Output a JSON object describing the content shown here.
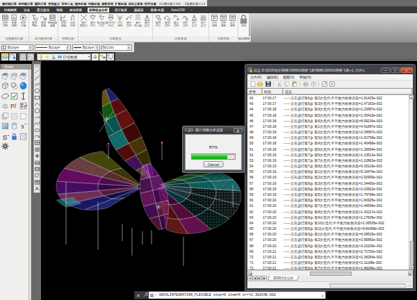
{
  "menubar": {
    "items": [
      "钢结构计算",
      "砼结构计算",
      "辅助计算",
      "查询显示",
      "常用工具",
      "通用处理",
      "结构处理",
      "参数查询",
      "扩展处理",
      "自定义菜单",
      "软件设置"
    ],
    "scale1": "【出图比例 1:25】",
    "scale2": "【绘图比例 1:1 】"
  },
  "tabbar": {
    "items": [
      "结构建模",
      "实体",
      "显示查询",
      "编辑",
      "施加荷载",
      "荷载组合分析",
      "设计验算",
      "膜裁剪",
      "楼梯-支座",
      "AutoCAD"
    ],
    "active": "荷载组合分析"
  },
  "ribbon": {
    "groups": [
      {
        "label": "自振特性计算",
        "buttons": [
          {
            "label1": "结构",
            "label2": "类型"
          },
          {
            "label1": "检查",
            "label2": "模型"
          },
          {
            "label1": "结构",
            "label2": "计算"
          }
        ]
      },
      {
        "label": "动力特性结果",
        "buttons": [
          {
            "label1": "查询",
            "label2": "周期"
          },
          {
            "label1": "查询",
            "label2": "振型"
          },
          {
            "label1": "周期振型",
            "label2": "参数"
          }
        ]
      },
      {
        "label": "时程分析",
        "buttons": [
          {
            "label1": "时程",
            "label2": "曲线"
          },
          {
            "label1": "动态",
            "label2": "位移"
          }
        ]
      },
      {
        "label": "结果显示",
        "buttons": [
          {
            "label1": "显示",
            "label2": "面应力"
          },
          {
            "label1": "显示",
            "label2": "内力"
          },
          {
            "label1": "最大组合",
            "label2": "内力"
          },
          {
            "label1": "显示内力",
            "label2": "标注"
          },
          {
            "label1": "内力",
            "label2": "包络"
          },
          {
            "label1": "显示",
            "label2": "位移"
          },
          {
            "label1": "显示",
            "label2": "等高线"
          },
          {
            "label1": "显示",
            "label2": "反力"
          }
        ]
      },
      {
        "label": "结果查询",
        "buttons": [
          {
            "label1": "查询",
            "label2": "内力"
          },
          {
            "label1": "查询",
            "label2": "位移"
          },
          {
            "label1": "最大",
            "label2": "位移"
          },
          {
            "label1": "相对",
            "label2": "位移"
          },
          {
            "label1": "单个",
            "label2": "反力"
          },
          {
            "label1": "多个",
            "label2": "反力"
          }
        ]
      },
      {
        "label": "结果表格",
        "buttons": [
          {
            "label1": "内力",
            "label2": "表格",
            "glyph": "F"
          },
          {
            "label1": "位移",
            "label2": "表格",
            "glyph": "D"
          },
          {
            "label1": "反力",
            "label2": "表格",
            "glyph": "R"
          }
        ]
      },
      {
        "label": "锁定解锁",
        "buttons": [
          {
            "label1": "锁定",
            "label2": ""
          }
        ]
      }
    ]
  },
  "propsbar": {
    "color": "ByLayer",
    "linetype": "ByLayer",
    "lineweight": "ByLayer",
    "plotstyle": "ByColor"
  },
  "layersbar": {
    "layer": "结构层"
  },
  "palette": {
    "title": "Tools"
  },
  "dialog": {
    "title": "工况1--累计荷载分析进度",
    "percent": "87%",
    "progress": 82,
    "cancel_label": "Cancel",
    "close_label": "x",
    "accent": "#2fce27"
  },
  "logwin": {
    "title": "日志 D:\\2019项目\\蝴蝶\\190601蝴蝶飞舞\\蝴蝶\\190601蝴蝶飞舞+1_V14.1",
    "menu": [
      "文件(F)",
      "编辑(E)",
      "视图(V)",
      "帮助(H)"
    ],
    "columns": [
      "序号",
      "时间",
      "信息"
    ],
    "rows": [
      {
        "seq": "42",
        "time": "17:00:17",
        "msg": "------正在进行第6步 第2次迭代,不平衡力收敛误差=1.81425e-002"
      },
      {
        "seq": "43",
        "time": "17:00:17",
        "msg": "------正在进行第6步 第3次迭代,不平衡力收敛误差=1.47163e-002"
      },
      {
        "seq": "44",
        "time": "17:00:18",
        "msg": "------正在进行第6步 第4次迭代,不平衡力收敛误差=1.23957e-002"
      },
      {
        "seq": "45",
        "time": "17:00:18",
        "msg": "------正在进行第6步 第5次迭代,不平衡力收敛误差=1.05419e-002"
      },
      {
        "seq": "46",
        "time": "17:00:18",
        "msg": "------正在进行第6步 第6次迭代,不平衡力收敛误差=8.99234e-003"
      },
      {
        "seq": "47",
        "time": "17:00:18",
        "msg": "------正在进行第7步 第1次迭代,不平衡力收敛误差=4.91897e-002"
      },
      {
        "seq": "48",
        "time": "17:00:18",
        "msg": "------正在进行第7步 第2次迭代,不平衡力收敛误差=2.08597e-002"
      },
      {
        "seq": "49",
        "time": "17:00:18",
        "msg": "------正在进行第7步 第3次迭代,不平衡力收敛误差=1.62758e-002"
      },
      {
        "seq": "50",
        "time": "17:00:18",
        "msg": "------正在进行第7步 第4次迭代,不平衡力收敛误差=1.40498e-002"
      },
      {
        "seq": "51",
        "time": "17:00:18",
        "msg": "------正在进行第7步 第5次迭代,不平衡力收敛误差=1.25654e-002"
      },
      {
        "seq": "52",
        "time": "17:00:19",
        "msg": "------正在进行第7步 第6次迭代,不平衡力收敛误差=1.13513e-002"
      },
      {
        "seq": "53",
        "time": "17:00:19",
        "msg": "------正在进行第7步 第7次迭代,不平衡力收敛误差=1.02863e-002"
      },
      {
        "seq": "54",
        "time": "17:00:19",
        "msg": "------正在进行第7步 第8次迭代,不平衡力收敛误差=9.33119e-003"
      },
      {
        "seq": "55",
        "time": "17:00:19",
        "msg": "------正在进行第8步 第1次迭代,不平衡力收敛误差=5.33476e-002"
      },
      {
        "seq": "56",
        "time": "17:00:19",
        "msg": "------正在进行第8步 第2次迭代,不平衡力收敛误差=2.92999e-002"
      },
      {
        "seq": "57",
        "time": "17:00:19",
        "msg": "------正在进行第8步 第3次迭代,不平衡力收敛误差=2.34490e-002"
      },
      {
        "seq": "58",
        "time": "17:00:19",
        "msg": "------正在进行第8步 第4次迭代,不平衡力收敛误差=2.02822e-002"
      },
      {
        "seq": "59",
        "time": "17:00:19",
        "msg": "------正在进行第8步 第5次迭代,不平衡力收敛误差=1.79798e-002"
      },
      {
        "seq": "60",
        "time": "17:00:20",
        "msg": "------正在进行第8步 第6次迭代,不平衡力收敛误差=1.60925e-002"
      },
      {
        "seq": "61",
        "time": "17:00:20",
        "msg": "------正在进行第8步 第7次迭代,不平衡力收敛误差=1.44596e-002"
      },
      {
        "seq": "62",
        "time": "17:00:20",
        "msg": "------正在进行第8步 第8次迭代,不平衡力收敛误差=1.30217e-002"
      },
      {
        "seq": "63",
        "time": "17:00:20",
        "msg": "------正在进行第8步 第9次迭代,不平衡力收敛误差=1.17635e-002"
      },
      {
        "seq": "64",
        "time": "17:00:20",
        "msg": "------正在进行第8步 第10次迭代,不平衡力收敛误差=1.06535e-002"
      },
      {
        "seq": "65",
        "time": "17:00:20",
        "msg": "------正在进行第8步 第11次迭代,不平衡力收敛误差=9.66458e-003"
      },
      {
        "seq": "66",
        "time": "17:00:20",
        "msg": "------正在进行第9步 第1次迭代,不平衡力收敛误差=6.08525e-002"
      },
      {
        "seq": "67",
        "time": "17:00:20",
        "msg": "------正在进行第9步 第2次迭代,不平衡力收敛误差=3.95850e-002"
      },
      {
        "seq": "68",
        "time": "17:00:20",
        "msg": "------正在进行第9步 第3次迭代,不平衡力收敛误差=3.20205e-002"
      },
      {
        "seq": "69",
        "time": "17:00:21",
        "msg": "------正在进行第9步 第4次迭代,不平衡力收敛误差=2.72700e-002"
      },
      {
        "seq": "70",
        "time": "17:00:21",
        "msg": "------正在进行第9步 第5次迭代,不平衡力收敛误差=2.38254e-002"
      },
      {
        "seq": "71",
        "time": "17:00:21",
        "msg": "------正在进行第9步 第6次迭代,不平衡力收敛误差=2.11198e-002"
      },
      {
        "seq": "72",
        "time": "17:00:21",
        "msg": "------正在进行第9步 第7次迭代,不平衡力收敛误差=1.88286e-002"
      }
    ],
    "tab": "3D3S力学分析"
  },
  "cmdbar": {
    "text": ": UNCALINTEGRATION_FLEXIBLE  step=9  item=5  err=2.38254E-002"
  }
}
